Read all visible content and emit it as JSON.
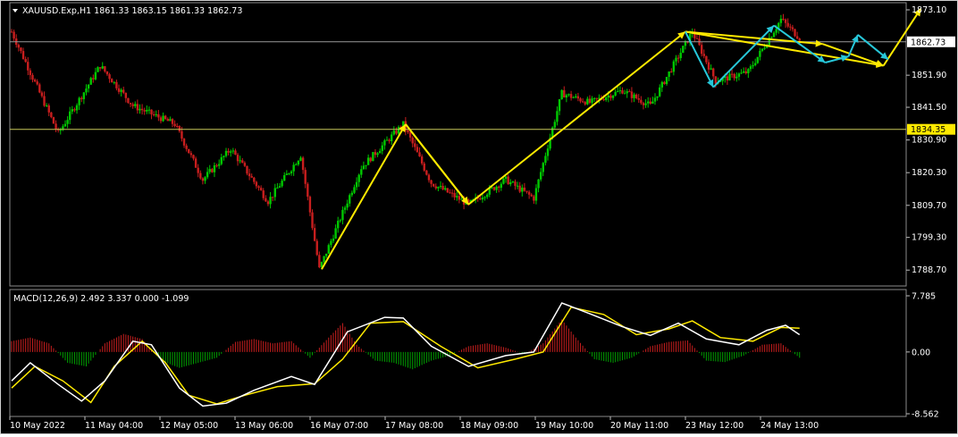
{
  "header": {
    "symbol_line": "XAUUSD.Exp,H1  1861.33 1863.15 1861.33 1862.73",
    "macd_line": "MACD(12,26,9) 2.492 3.337 0.000 -1.099"
  },
  "chart_data": [
    {
      "type": "candlestick",
      "symbol": "XAUUSD.Exp",
      "timeframe": "H1",
      "ohlc_current": {
        "open": 1861.33,
        "high": 1863.15,
        "low": 1861.33,
        "close": 1862.73
      },
      "ylim": [
        1785.0,
        1873.1
      ],
      "y_ticks": [
        "1873.10",
        "1851.90",
        "1841.50",
        "1830.90",
        "1820.30",
        "1809.70",
        "1799.30",
        "1788.70"
      ],
      "price_labels": {
        "current": "1862.73",
        "level": "1834.35"
      },
      "horizontal_lines": [
        1862.73,
        1834.35
      ],
      "x_ticks": [
        "10 May 2022",
        "11 May 04:00",
        "12 May 05:00",
        "13 May 06:00",
        "16 May 07:00",
        "17 May 08:00",
        "18 May 09:00",
        "19 May 10:00",
        "20 May 11:00",
        "23 May 12:00",
        "24 May 13:00"
      ],
      "key_points": [
        {
          "t": 0,
          "price": 1866
        },
        {
          "t": 20,
          "price": 1833
        },
        {
          "t": 38,
          "price": 1855
        },
        {
          "t": 52,
          "price": 1842
        },
        {
          "t": 70,
          "price": 1836
        },
        {
          "t": 82,
          "price": 1818
        },
        {
          "t": 94,
          "price": 1828
        },
        {
          "t": 110,
          "price": 1811
        },
        {
          "t": 124,
          "price": 1826
        },
        {
          "t": 132,
          "price": 1789
        },
        {
          "t": 150,
          "price": 1822
        },
        {
          "t": 168,
          "price": 1836
        },
        {
          "t": 180,
          "price": 1817
        },
        {
          "t": 196,
          "price": 1810
        },
        {
          "t": 212,
          "price": 1818
        },
        {
          "t": 224,
          "price": 1812
        },
        {
          "t": 236,
          "price": 1846
        },
        {
          "t": 248,
          "price": 1843
        },
        {
          "t": 262,
          "price": 1847
        },
        {
          "t": 274,
          "price": 1842
        },
        {
          "t": 292,
          "price": 1866
        },
        {
          "t": 302,
          "price": 1850
        },
        {
          "t": 316,
          "price": 1853
        },
        {
          "t": 330,
          "price": 1870
        },
        {
          "t": 338,
          "price": 1864
        }
      ],
      "projection_lines": [
        {
          "color": "#ffea00",
          "points": [
            [
              133,
              1789
            ],
            [
              169,
              1836
            ],
            [
              196,
              1810
            ],
            [
              289,
              1866
            ],
            [
              374,
              1855
            ],
            [
              390,
              1873.5
            ]
          ]
        },
        {
          "color": "#ffea00",
          "points": [
            [
              169,
              1836
            ],
            [
              196,
              1810
            ]
          ]
        },
        {
          "color": "#ffea00",
          "points": [
            [
              289,
              1866
            ],
            [
              348,
              1862
            ],
            [
              374,
              1855
            ]
          ]
        },
        {
          "color": "#27c7d9",
          "points": [
            [
              289,
              1866
            ],
            [
              301,
              1848
            ],
            [
              327,
              1868
            ],
            [
              349,
              1856
            ],
            [
              359,
              1858
            ],
            [
              363,
              1865
            ],
            [
              376,
              1857
            ]
          ]
        }
      ]
    },
    {
      "type": "macd",
      "params": "MACD(12,26,9)",
      "values": {
        "macd": 2.492,
        "signal": 3.337,
        "histogram": 0.0,
        "extra": -1.099
      },
      "ylim": [
        -8.562,
        7.785
      ],
      "y_ticks": [
        "7.785",
        "0.00",
        "-8.562"
      ],
      "macd_points": [
        [
          0,
          -4
        ],
        [
          8,
          -1.5
        ],
        [
          20,
          -4.5
        ],
        [
          30,
          -6.8
        ],
        [
          40,
          -4
        ],
        [
          52,
          1.5
        ],
        [
          60,
          1
        ],
        [
          72,
          -5
        ],
        [
          82,
          -7.5
        ],
        [
          92,
          -7.1
        ],
        [
          104,
          -5.3
        ],
        [
          120,
          -3.4
        ],
        [
          130,
          -4.5
        ],
        [
          144,
          2.8
        ],
        [
          160,
          4.8
        ],
        [
          168,
          4.7
        ],
        [
          180,
          0.8
        ],
        [
          196,
          -2
        ],
        [
          212,
          -0.5
        ],
        [
          224,
          0
        ],
        [
          236,
          6.8
        ],
        [
          248,
          5.3
        ],
        [
          262,
          3.5
        ],
        [
          274,
          2.3
        ],
        [
          286,
          4
        ],
        [
          298,
          1.8
        ],
        [
          312,
          1
        ],
        [
          324,
          3
        ],
        [
          332,
          3.7
        ],
        [
          338,
          2.4
        ]
      ],
      "signal_points": [
        [
          0,
          -5
        ],
        [
          10,
          -2
        ],
        [
          22,
          -4
        ],
        [
          34,
          -7
        ],
        [
          44,
          -2
        ],
        [
          56,
          1.5
        ],
        [
          66,
          -1.5
        ],
        [
          76,
          -6
        ],
        [
          88,
          -7.2
        ],
        [
          100,
          -6
        ],
        [
          114,
          -4.8
        ],
        [
          130,
          -4.4
        ],
        [
          142,
          -1
        ],
        [
          154,
          4
        ],
        [
          168,
          4.2
        ],
        [
          184,
          0.8
        ],
        [
          200,
          -2.2
        ],
        [
          216,
          -1
        ],
        [
          228,
          0
        ],
        [
          240,
          6.2
        ],
        [
          254,
          5.2
        ],
        [
          268,
          2.4
        ],
        [
          282,
          3.2
        ],
        [
          292,
          4.3
        ],
        [
          304,
          2
        ],
        [
          318,
          1.5
        ],
        [
          330,
          3.4
        ],
        [
          338,
          3.3
        ]
      ],
      "histogram_points": [
        [
          0,
          1.5
        ],
        [
          8,
          2
        ],
        [
          16,
          1.2
        ],
        [
          24,
          -1.5
        ],
        [
          32,
          -2
        ],
        [
          40,
          1.2
        ],
        [
          48,
          2.5
        ],
        [
          56,
          1.8
        ],
        [
          64,
          -1.2
        ],
        [
          72,
          -2.2
        ],
        [
          80,
          -1.5
        ],
        [
          88,
          -0.8
        ],
        [
          96,
          1.4
        ],
        [
          104,
          1.8
        ],
        [
          112,
          1.2
        ],
        [
          120,
          1.5
        ],
        [
          128,
          -0.8
        ],
        [
          136,
          2
        ],
        [
          142,
          4
        ],
        [
          148,
          1
        ],
        [
          156,
          -1.2
        ],
        [
          164,
          -1.5
        ],
        [
          172,
          -2.4
        ],
        [
          180,
          -1.2
        ],
        [
          188,
          -0.5
        ],
        [
          196,
          0.8
        ],
        [
          204,
          1.2
        ],
        [
          212,
          0.6
        ],
        [
          220,
          -0.3
        ],
        [
          228,
          1.2
        ],
        [
          236,
          4.5
        ],
        [
          242,
          2
        ],
        [
          250,
          -1
        ],
        [
          258,
          -1.5
        ],
        [
          266,
          -0.8
        ],
        [
          274,
          0.8
        ],
        [
          282,
          1.4
        ],
        [
          290,
          1.6
        ],
        [
          298,
          -1.2
        ],
        [
          306,
          -1.4
        ],
        [
          314,
          -0.5
        ],
        [
          322,
          1
        ],
        [
          330,
          1.2
        ],
        [
          338,
          -0.8
        ]
      ]
    }
  ]
}
